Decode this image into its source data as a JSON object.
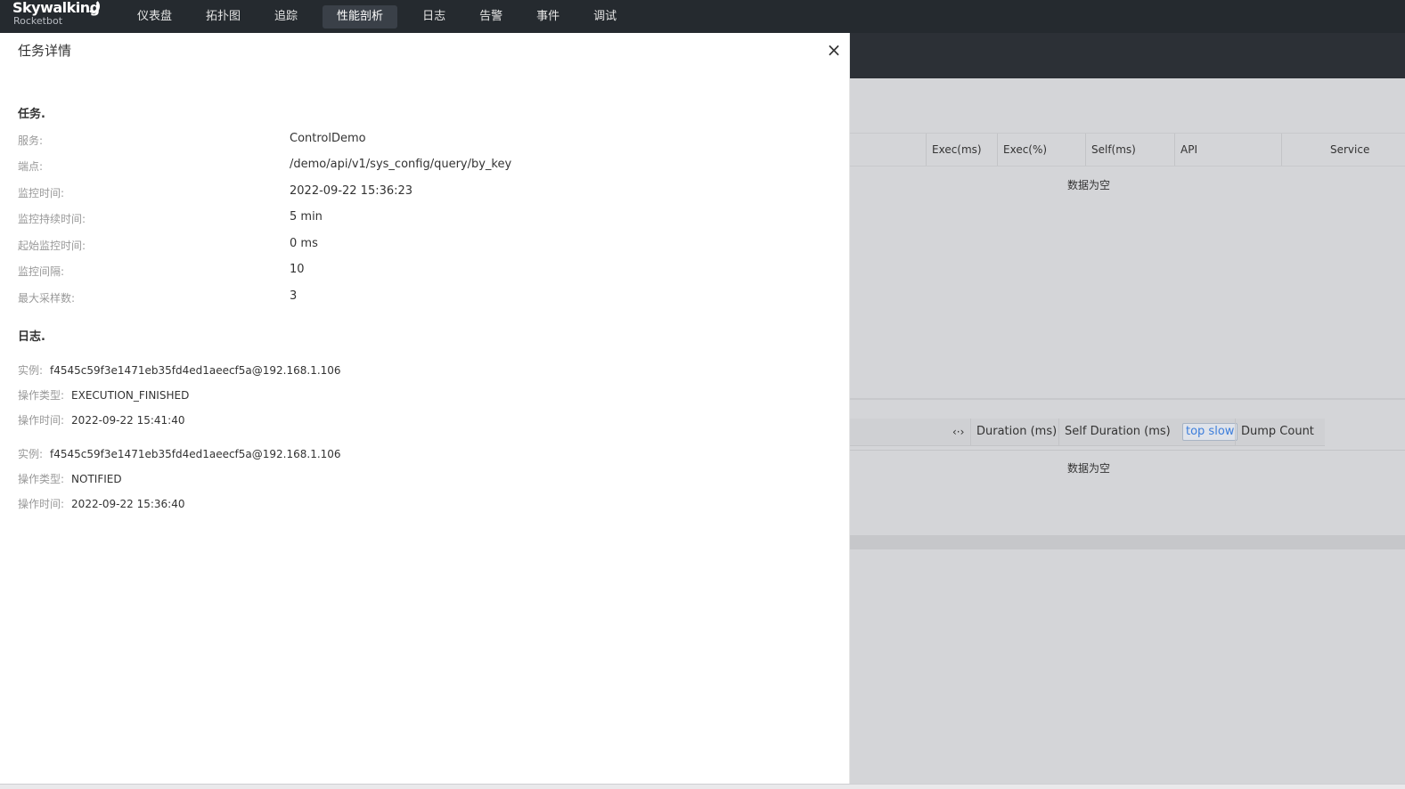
{
  "app": {
    "logo_main": "Skywalking",
    "logo_sub": "Rocketbot"
  },
  "nav": {
    "items": [
      {
        "label": "仪表盘"
      },
      {
        "label": "拓扑图"
      },
      {
        "label": "追踪"
      },
      {
        "label": "性能剖析",
        "active": true
      },
      {
        "label": "日志"
      },
      {
        "label": "告警"
      },
      {
        "label": "事件"
      },
      {
        "label": "调试"
      }
    ]
  },
  "drawer": {
    "title": "任务详情",
    "close_label": "×",
    "task_section": "任务.",
    "task_fields": [
      {
        "label": "服务:",
        "value": "ControlDemo"
      },
      {
        "label": "端点:",
        "value": "/demo/api/v1/sys_config/query/by_key"
      },
      {
        "label": "监控时间:",
        "value": "2022-09-22 15:36:23"
      },
      {
        "label": "监控持续时间:",
        "value": "5 min"
      },
      {
        "label": "起始监控时间:",
        "value": "0 ms"
      },
      {
        "label": "监控间隔:",
        "value": "10"
      },
      {
        "label": "最大采样数:",
        "value": "3"
      }
    ],
    "log_section": "日志.",
    "logs": [
      {
        "instance_label": "实例:",
        "instance": "f4545c59f3e1471eb35fd4ed1aeecf5a@192.168.1.106",
        "op_type_label": "操作类型:",
        "op_type": "EXECUTION_FINISHED",
        "op_time_label": "操作时间:",
        "op_time": "2022-09-22 15:41:40"
      },
      {
        "instance_label": "实例:",
        "instance": "f4545c59f3e1471eb35fd4ed1aeecf5a@192.168.1.106",
        "op_type_label": "操作类型:",
        "op_type": "NOTIFIED",
        "op_time_label": "操作时间:",
        "op_time": "2022-09-22 15:36:40"
      }
    ]
  },
  "background": {
    "table1_headers": [
      "Exec(ms)",
      "Exec(%)",
      "Self(ms)",
      "API",
      "Service"
    ],
    "table1_empty": "数据为空",
    "table2_toggle": "‹·›",
    "table2_headers": [
      "Duration (ms)",
      "Self Duration (ms)"
    ],
    "table2_top_slow": "top slow",
    "table2_dump_count": "Dump Count",
    "table2_empty": "数据为空"
  }
}
